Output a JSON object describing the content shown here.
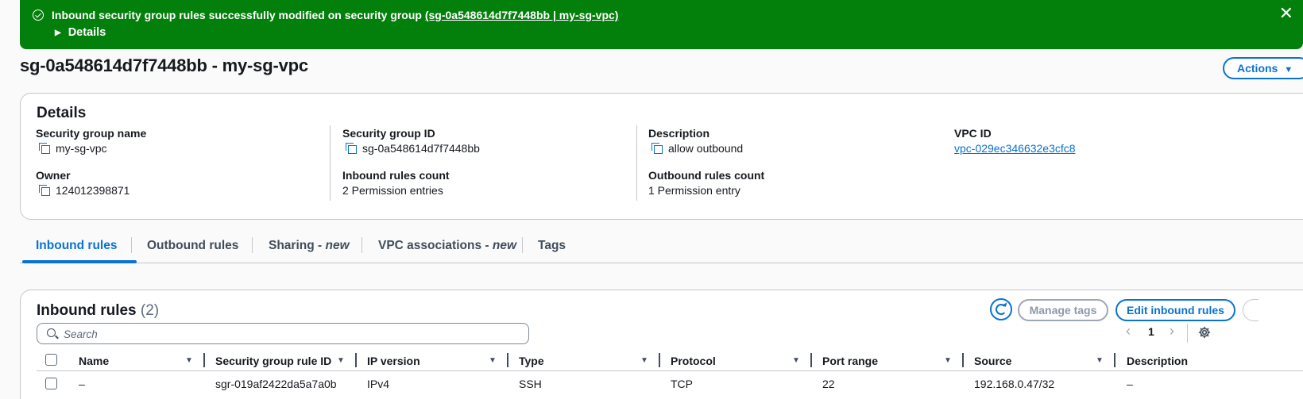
{
  "flash": {
    "message": "Inbound security group rules successfully modified on security group ",
    "link": "(sg-0a548614d7f7448bb | my-sg-vpc)",
    "details": "Details",
    "close": "✕"
  },
  "header": {
    "title": "sg-0a548614d7f7448bb - my-sg-vpc",
    "actions": "Actions",
    "actions_caret": "▼"
  },
  "details": {
    "title": "Details",
    "fields": {
      "sg_name_label": "Security group name",
      "sg_name": "my-sg-vpc",
      "sg_id_label": "Security group ID",
      "sg_id": "sg-0a548614d7f7448bb",
      "description_label": "Description",
      "description": "allow outbound",
      "vpc_id_label": "VPC ID",
      "vpc_id": "vpc-029ec346632e3cfc8",
      "owner_label": "Owner",
      "owner": "124012398871",
      "inbound_count_label": "Inbound rules count",
      "inbound_count": "2 Permission entries",
      "outbound_count_label": "Outbound rules count",
      "outbound_count": "1 Permission entry"
    }
  },
  "tabs": {
    "inbound": "Inbound rules",
    "outbound": "Outbound rules",
    "sharing": "Sharing - ",
    "sharing_new": "new",
    "vpc_assoc": "VPC associations - ",
    "vpc_assoc_new": "new",
    "tags": "Tags"
  },
  "rules": {
    "title": "Inbound rules",
    "count": "(2)",
    "manage_tags": "Manage tags",
    "edit": "Edit inbound rules",
    "search_placeholder": "Search",
    "page": "1",
    "prev": "‹",
    "next": "›",
    "columns": {
      "name": "Name",
      "rule_id": "Security group rule ID",
      "ip_version": "IP version",
      "type": "Type",
      "protocol": "Protocol",
      "port_range": "Port range",
      "source": "Source",
      "description": "Description"
    },
    "rows": [
      {
        "name": "–",
        "rule_id": "sgr-019af2422da5a7a0b",
        "ip_version": "IPv4",
        "type": "SSH",
        "protocol": "TCP",
        "port_range": "22",
        "source": "192.168.0.47/32",
        "description": "–"
      }
    ]
  }
}
